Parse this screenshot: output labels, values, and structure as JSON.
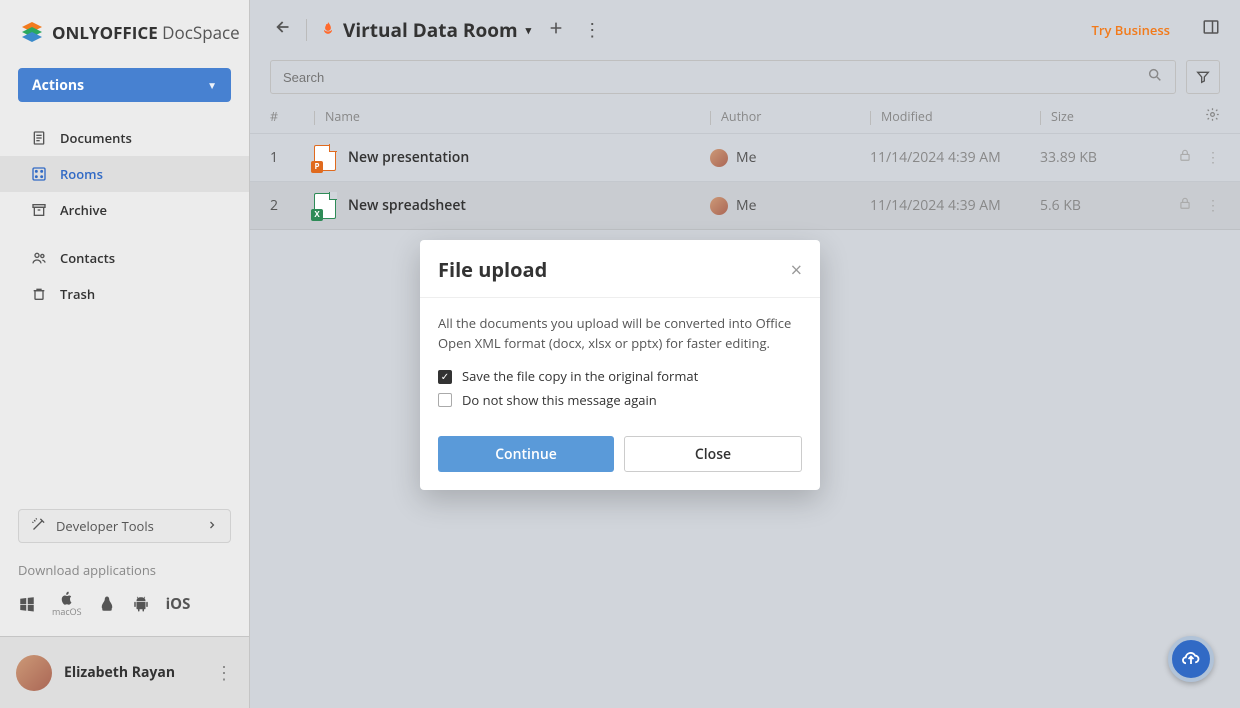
{
  "brand": {
    "strong": "ONLYOFFICE",
    "light": " DocSpace"
  },
  "sidebar": {
    "actions_label": "Actions",
    "items": [
      {
        "label": "Documents"
      },
      {
        "label": "Rooms"
      },
      {
        "label": "Archive"
      },
      {
        "label": "Contacts"
      },
      {
        "label": "Trash"
      }
    ],
    "dev_tools": "Developer Tools",
    "download_apps": "Download applications"
  },
  "user": {
    "name": "Elizabeth Rayan"
  },
  "header": {
    "title": "Virtual Data Room",
    "try_business": "Try Business"
  },
  "search": {
    "placeholder": "Search"
  },
  "table": {
    "columns": {
      "idx": "#",
      "name": "Name",
      "author": "Author",
      "modified": "Modified",
      "size": "Size"
    },
    "rows": [
      {
        "idx": "1",
        "name": "New presentation",
        "author": "Me",
        "modified": "11/14/2024 4:39 AM",
        "size": "33.89 KB"
      },
      {
        "idx": "2",
        "name": "New spreadsheet",
        "author": "Me",
        "modified": "11/14/2024 4:39 AM",
        "size": "5.6 KB"
      }
    ]
  },
  "modal": {
    "title": "File upload",
    "body": "All the documents you upload will be converted into Office Open XML format (docx, xlsx or pptx) for faster editing.",
    "check1": "Save the file copy in the original format",
    "check2": "Do not show this message again",
    "continue": "Continue",
    "close": "Close"
  }
}
